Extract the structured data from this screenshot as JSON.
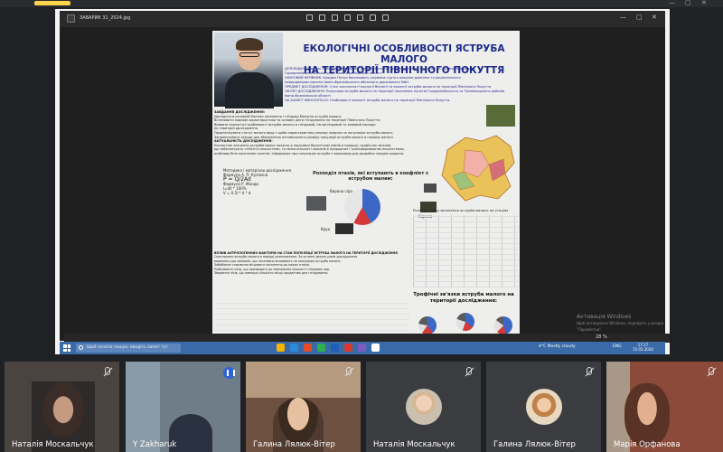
{
  "viewer": {
    "filename": "ЗАВАРИК 31_2024.jpg",
    "zoom": "28 %"
  },
  "poster": {
    "title_line1": "ЕКОЛОГІЧНІ ОСОБЛИВОСТІ ЯСТРУБА МАЛОГО",
    "title_line2": "НА ТЕРИТОРІЇ ПІВНІЧНОГО ПОКУТТЯ",
    "author_lines": [
      "ДОПОВІДАЧ: Заварик Ярослав Михайлович, учень 9-А класу Городенківського ліцею ім. Ак. Кравчельницького",
      "Городенківської міської ради Івано-Франківської області",
      "НАУКОВИЙ КЕРІВНИК: Бувдюк Петро Васильович, керівник гуртка охорони довкілля та раціонального",
      "природокористування Івано-Франківського обласного державного МАН",
      "ПРЕДМЕТ ДОСЛІДЖЕННЯ: Стан чисельності екології біології та екології яструба малого на території Північного Покуття",
      "ОБ'ЄКТ ДОСЛІДЖЕННЯ: Популяція яструба малого на території населених пунктів Городенківського та Тисменицького районів",
      "Івано-Франківської області",
      "НА ЗАХИСТ ВИНОСИТЬСЯ: Особливості екології яструба малого на території Північного Покуття."
    ],
    "tasks_heading": "ЗАВДАННЯ ДОСЛІДЖЕННЯ:",
    "tasks_lines": [
      "Дослідити в основній біотопи заселення і гніздову біологію яструба малого.",
      "Встановити кормові характеристики та основні дієти гніздування на території Північного Покуття.",
      "Виявити екологічні особливості яструба малого в гніздовий, післягніздовий та зимовий періоди",
      "на території дослідження.",
      "Проаналізувати статус малого виду з щоби характеристику впливу людини на популяцію яструба малого.",
      "Запропонувати заходи для збереження оптимального розміру популяції яструба малого в нашому регіоні."
    ],
    "actuality_heading": "АКТУАЛЬНІСТЬ ДОСЛІДЖЕННЯ:",
    "actuality_lines": [
      "Екологічне значення яструбів малих полягає в підтримці біологічних рівнів в природі, трофічних зв'язків,",
      "що забезпечують стійкість екосистеми, та зміни кількості хижаків в природних і трансформованих екосистемах,",
      "особливо біля населених пунктів. Інформація про популяцію яструба є важливою для розробки заходів охорони."
    ],
    "method_heading": "Методика і матеріали дослідження.",
    "formula_author1": "Формула А. П. Кузякіна",
    "formula1": "P = Q/2Ad",
    "formula_author2": "Формула Р. Манди",
    "formula2a": "I=d/l * 100%",
    "formula2b": "V = 0.5l * d * d",
    "ravens_caption": "Розподіл птахів, які вступають в конфлікт з яструбом малим:",
    "ravens_labels": [
      "Ворона сіра",
      "Сорока",
      "Крук"
    ],
    "table1_caption": "Розподіл гнізд заселення яструба малого по стаціях",
    "anthro_heading": "ВПЛИВ АНТРОПОГЕННИХ ФАКТОРІВ НА СТАН ПОПУЛЯЦІЇ ЯСТРУБА МАЛОГО НА ТЕРИТОРІЇ ДОСЛІДЖЕННЯ",
    "anthro_lines": [
      "Спостережи яструба малого в періоді розмноження. За останні десять років дослідження",
      "виявлено ряд чинників, що негативно впливають на популяцію яструба малого.",
      "Забобонне ставлення місцевого населення до хижих птахів.",
      "Руйнування гнізд, що призводить до зменшення кількості гніздових пар.",
      "Зведення лісів, що зменшує кількість місць придатних для гніздування."
    ],
    "trophic_title": "Трофічні зв'язки яструба малого на території дослідження:"
  },
  "watermark": {
    "line1": "Активація Windows",
    "line2": "Щоб активувати Windows, перейдіть у розділ \"Параметри\"."
  },
  "taskbar": {
    "search_placeholder": "Щоб почати пошук, введіть запит тут",
    "weather": "4°C Mostly cloudy",
    "lang": "ENG",
    "time": "17:17",
    "date": "15.03.2024"
  },
  "participants": [
    {
      "name": "Наталія Москальчук"
    },
    {
      "name": "Y Zakharuk"
    },
    {
      "name": "Галина Лялюк-Вітер"
    },
    {
      "name": "Наталія Москальчук"
    },
    {
      "name": "Галина Лялюк-Вітер"
    },
    {
      "name": "Марія Орфанова"
    }
  ],
  "colors": {
    "title_blue": "#1a2a8a",
    "taskbar": "#3a6ba8",
    "speaking_outline": "#4f7fe0"
  }
}
